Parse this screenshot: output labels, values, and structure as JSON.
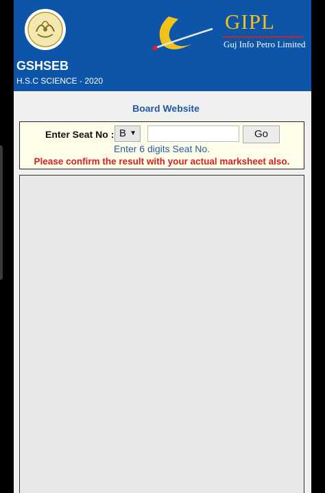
{
  "header": {
    "title": "GSHSEB",
    "subtitle": "H.S.C SCIENCE - 2020",
    "partner_logo_name": "GIPL",
    "partner_logo_tagline": "Guj Info Petro Limited",
    "background_color": "#0d55a8"
  },
  "board_link": "Board Website",
  "search": {
    "label": "Enter Seat No :",
    "series_value": "B",
    "seat_input_value": "",
    "go_label": "Go",
    "hint": "Enter 6 digits Seat No.",
    "warning": "Please confirm the result with your actual marksheet also."
  },
  "icons": {
    "board_emblem": "board-emblem-icon",
    "dropdown": "chevron-down-icon"
  },
  "colors": {
    "warning_text": "#d62020",
    "hint_text": "#2a5a9c",
    "search_bg": "#fdfdea"
  }
}
